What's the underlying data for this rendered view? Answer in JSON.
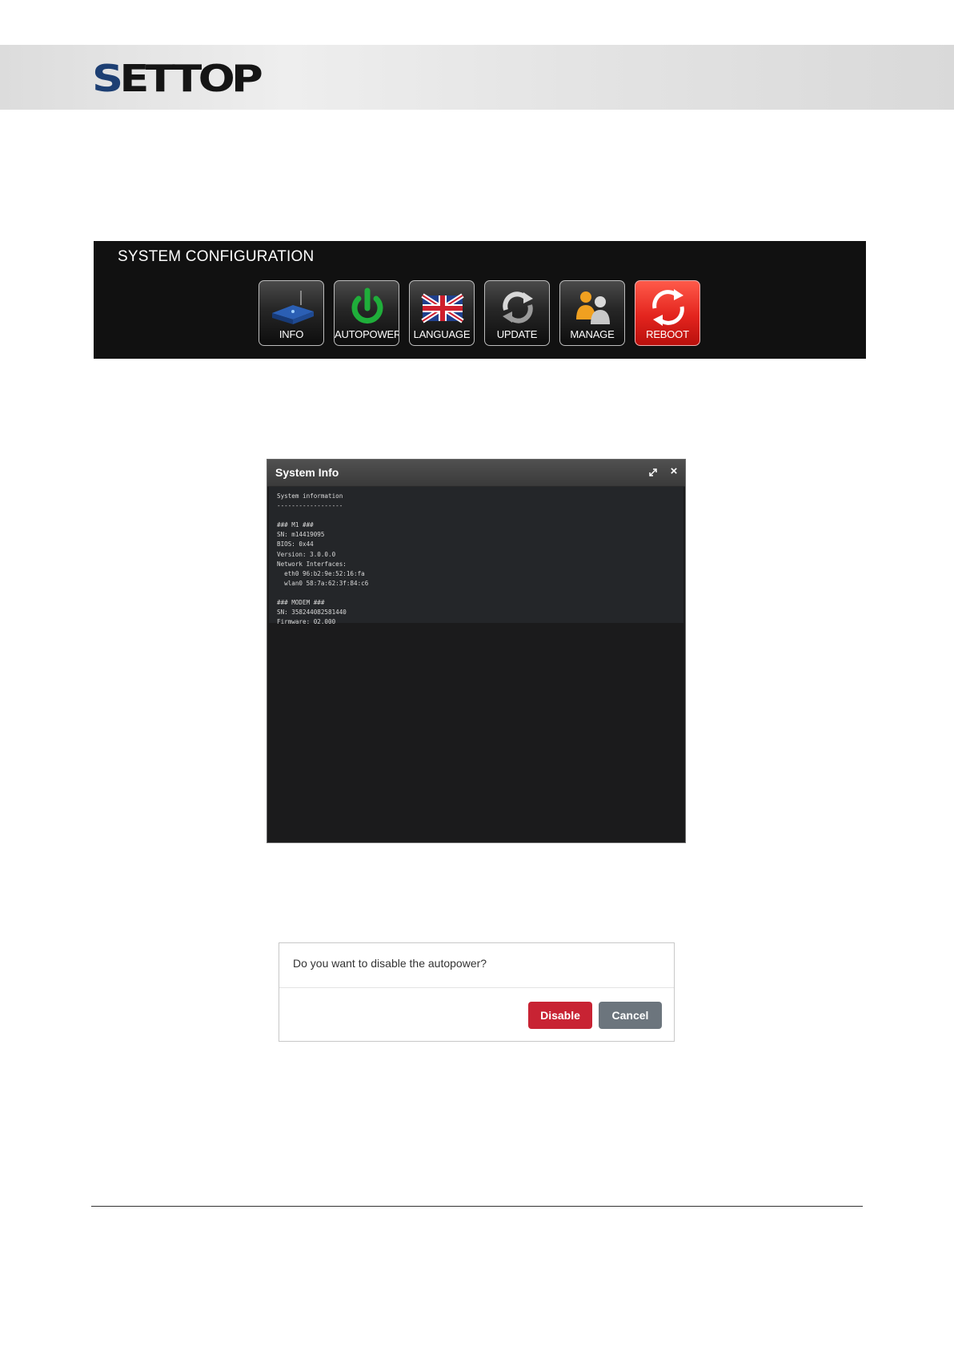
{
  "header": {
    "logo_first": "S",
    "logo_rest": "ETTOP"
  },
  "config": {
    "title": "SYSTEM CONFIGURATION",
    "tiles": [
      {
        "label": "INFO",
        "icon": "router-icon"
      },
      {
        "label": "AUTOPOWER",
        "icon": "power-icon"
      },
      {
        "label": "LANGUAGE",
        "icon": "uk-flag-icon"
      },
      {
        "label": "UPDATE",
        "icon": "refresh-icon"
      },
      {
        "label": "MANAGE",
        "icon": "users-icon"
      },
      {
        "label": "REBOOT",
        "icon": "reboot-icon",
        "color": "#e3241e"
      }
    ]
  },
  "system_info": {
    "title": "System Info",
    "text": "System information\n------------------\n\n### M1 ###\nSN: m14419095\nBIOS: 0x44\nVersion: 3.0.0.0\nNetwork Interfaces:\n  eth0 96:b2:9e:52:16:fa\n  wlan0 58:7a:62:3f:84:c6\n\n### MODEM ###\nSN: 358244082581440\nFirmware: 02.000"
  },
  "dialog": {
    "message": "Do you want to disable the autopower?",
    "disable_label": "Disable",
    "cancel_label": "Cancel",
    "disable_color": "#c82333",
    "cancel_color": "#6c757d"
  }
}
